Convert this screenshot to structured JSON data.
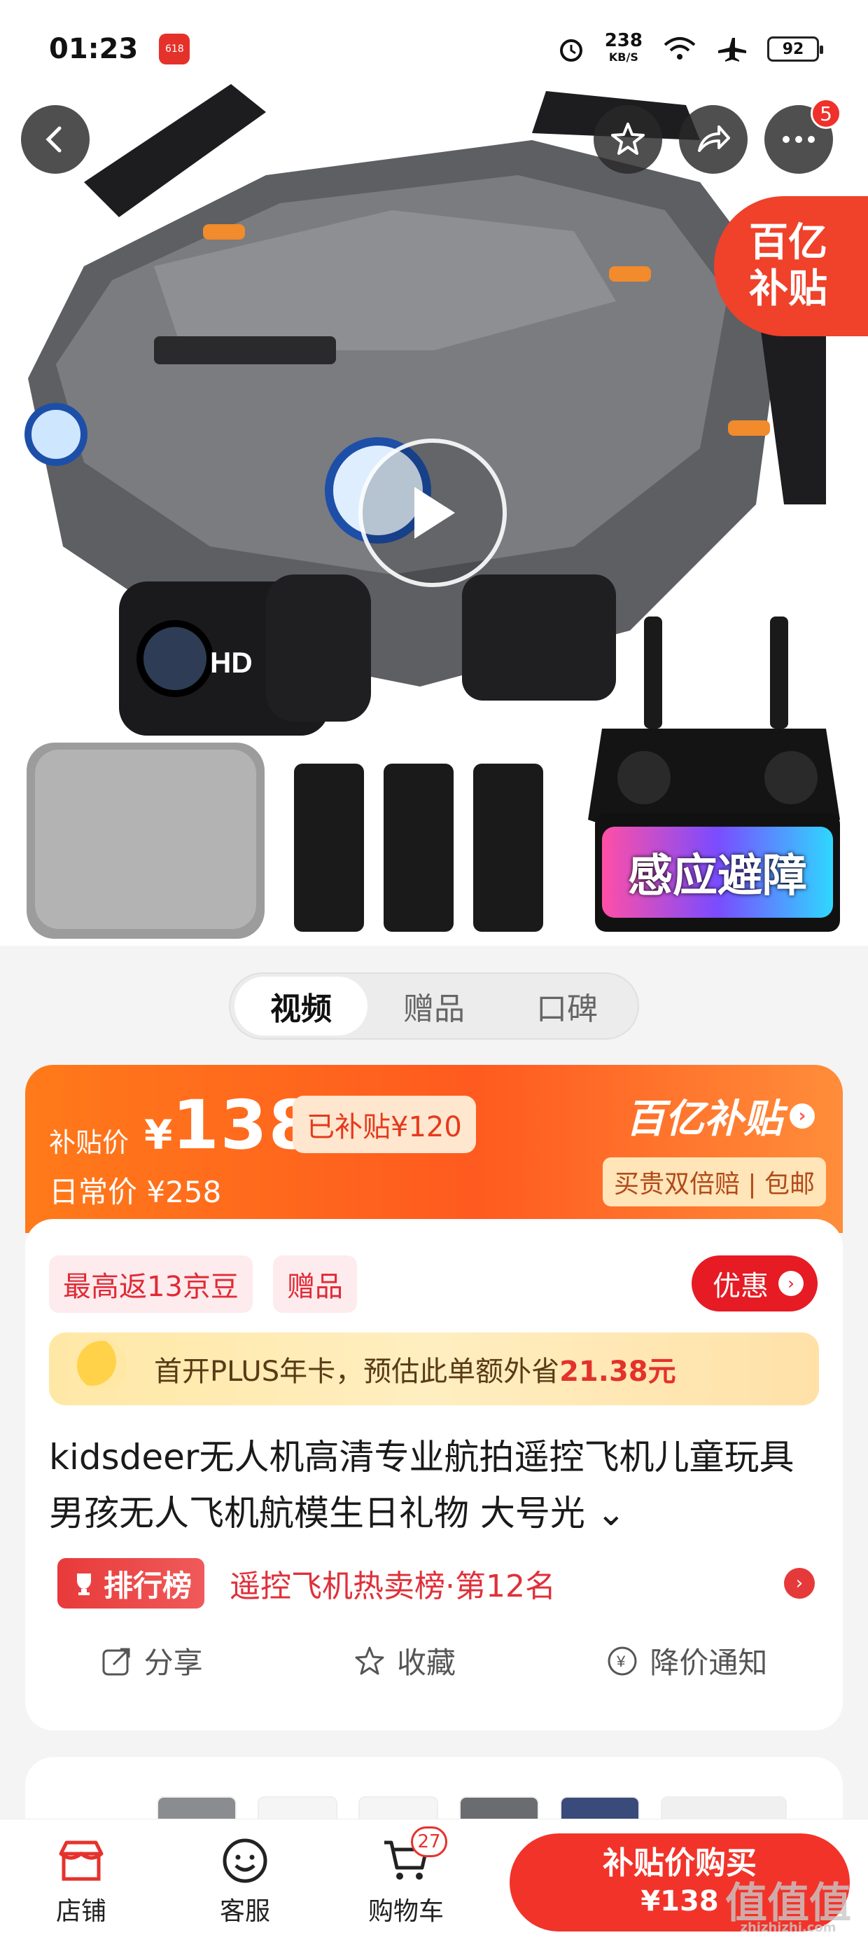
{
  "status_bar": {
    "time": "01:23",
    "app_badge": "618",
    "speed_value": "238",
    "speed_unit": "KB/S",
    "battery": "92"
  },
  "hero": {
    "subsidy_corner": [
      "百亿",
      "补贴"
    ],
    "overlay_caption": "感应避障",
    "more_badge": "5",
    "colors": {
      "accent": "#f0412a"
    }
  },
  "media_tabs": [
    {
      "label": "视频",
      "active": true
    },
    {
      "label": "赠品",
      "active": false
    },
    {
      "label": "口碑",
      "active": false
    }
  ],
  "price": {
    "label": "补贴价",
    "currency": "¥",
    "value": "138",
    "subsidy_chip": "已补贴¥120",
    "daily_price": "日常价 ¥258",
    "brand": "百亿补贴",
    "guarantee": "买贵双倍赔 | 包邮"
  },
  "promo": {
    "tag_beans": "最高返13京豆",
    "tag_gift": "赠品",
    "coupon": "优惠",
    "plus_text": "首开PLUS年卡，预估此单额外省",
    "plus_amount": "21.38元"
  },
  "product": {
    "title": "kidsdeer无人机高清专业航拍遥控飞机儿童玩具男孩无人飞机航模生日礼物 大号光",
    "rank_badge": "排行榜",
    "rank_text": "遥控飞机热卖榜·第12名"
  },
  "actions": [
    {
      "label": "分享",
      "icon": "share-icon"
    },
    {
      "label": "收藏",
      "icon": "star-icon"
    },
    {
      "label": "降价通知",
      "icon": "price-alert-icon"
    }
  ],
  "bottom_bar": {
    "shop": "店铺",
    "service": "客服",
    "cart": "购物车",
    "cart_count": "27",
    "buy_line1": "补贴价购买",
    "buy_line2": "¥138"
  },
  "watermark": {
    "main": "值值值",
    "sub": "zhizhizhi.com"
  }
}
